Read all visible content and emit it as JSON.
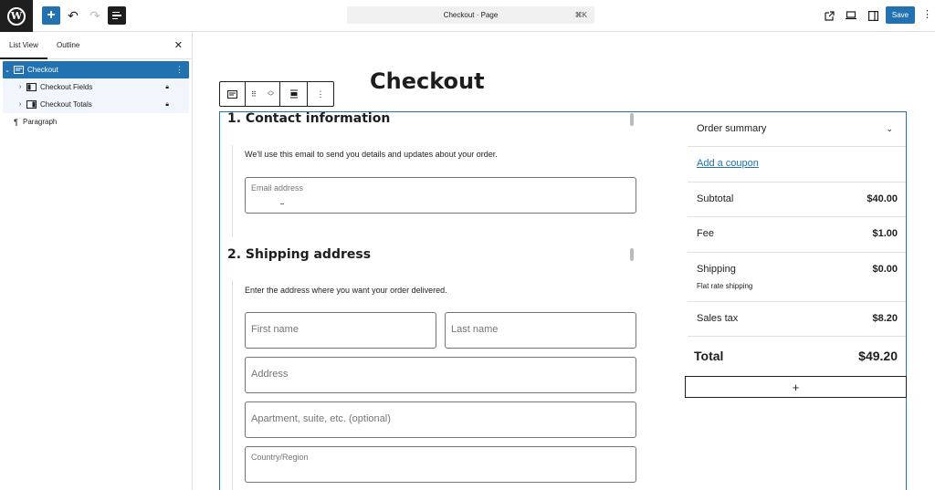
{
  "header": {
    "doc_title": "Checkout · Page",
    "shortcut": "⌘K",
    "save_label": "Save",
    "logo_letter": "W"
  },
  "sidebar": {
    "tabs": [
      "List View",
      "Outline"
    ],
    "items": [
      {
        "label": "Checkout"
      },
      {
        "label": "Checkout Fields"
      },
      {
        "label": "Checkout Totals"
      },
      {
        "label": "Paragraph"
      }
    ]
  },
  "canvas": {
    "page_title": "Checkout",
    "contact": {
      "heading": "1.  Contact information",
      "help": "We'll use this email to send you details and updates about your order.",
      "email_label": "Email address"
    },
    "shipping": {
      "heading": "2.  Shipping address",
      "help": "Enter the address where you want your order delivered.",
      "first_name": "First name",
      "last_name": "Last name",
      "address": "Address",
      "apartment": "Apartment, suite, etc. (optional)",
      "country": "Country/Region"
    },
    "summary": {
      "title": "Order summary",
      "coupon": "Add a coupon",
      "subtotal_label": "Subtotal",
      "subtotal_value": "$40.00",
      "fee_label": "Fee",
      "fee_value": "$1.00",
      "shipping_label": "Shipping",
      "shipping_value": "$0.00",
      "shipping_method": "Flat rate shipping",
      "tax_label": "Sales tax",
      "tax_value": "$8.20",
      "total_label": "Total",
      "total_value": "$49.20"
    }
  },
  "colors": {
    "accent": "#2271b1",
    "dark": "#1e1e1e"
  }
}
